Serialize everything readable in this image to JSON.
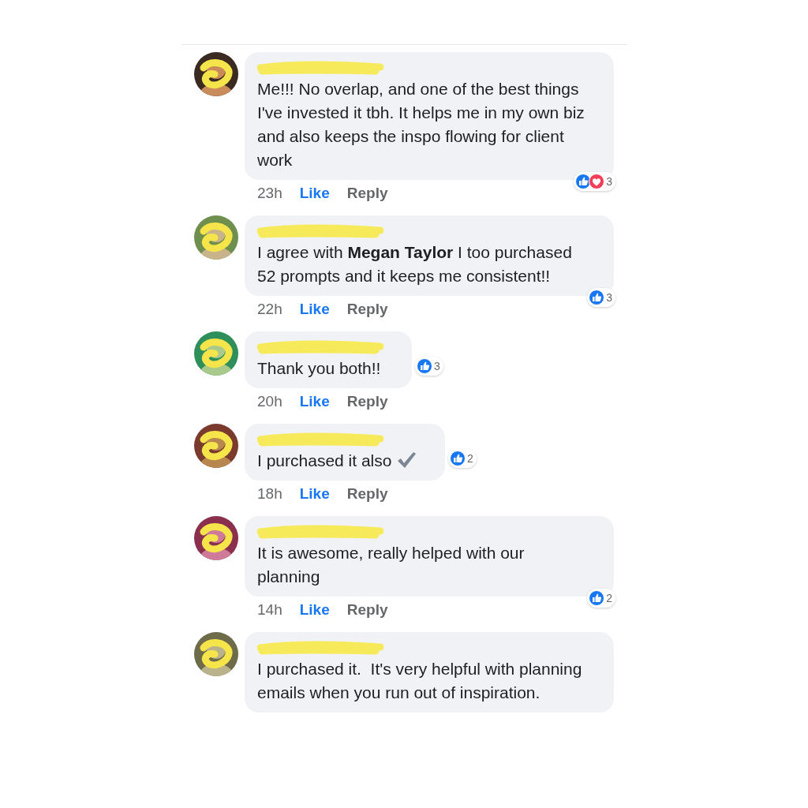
{
  "comments": [
    {
      "text": "Me!!! No overlap, and one of the best things I've invested it tbh. It helps me in my own biz and also keeps the inspo flowing for client work",
      "reactions": [
        {
          "kind": "like"
        },
        {
          "kind": "love"
        }
      ],
      "reaction_count": "3",
      "time": "23h",
      "actions": [
        "Like",
        "Reply"
      ]
    },
    {
      "text": "I agree with **Megan Taylor** I too purchased 52 prompts and it keeps me consistent!!",
      "reactions": [
        {
          "kind": "like"
        }
      ],
      "reaction_count": "3",
      "time": "22h",
      "actions": [
        "Like",
        "Reply"
      ]
    },
    {
      "text": "Thank you both!!",
      "reactions": [
        {
          "kind": "like"
        }
      ],
      "reaction_count": "3",
      "time": "20h",
      "actions": [
        "Like",
        "Reply"
      ]
    },
    {
      "text": "I purchased it also",
      "emoji": {
        "kind": "check"
      },
      "reactions": [
        {
          "kind": "like"
        }
      ],
      "reaction_count": "2",
      "time": "18h",
      "actions": [
        "Like",
        "Reply"
      ]
    },
    {
      "text": "It is awesome, really helped with our planning",
      "reactions": [
        {
          "kind": "like"
        }
      ],
      "reaction_count": "2",
      "time": "14h",
      "actions": [
        "Like",
        "Reply"
      ]
    },
    {
      "text": "I purchased it.  It's very helpful with planning emails when you run out of inspiration."
    }
  ]
}
